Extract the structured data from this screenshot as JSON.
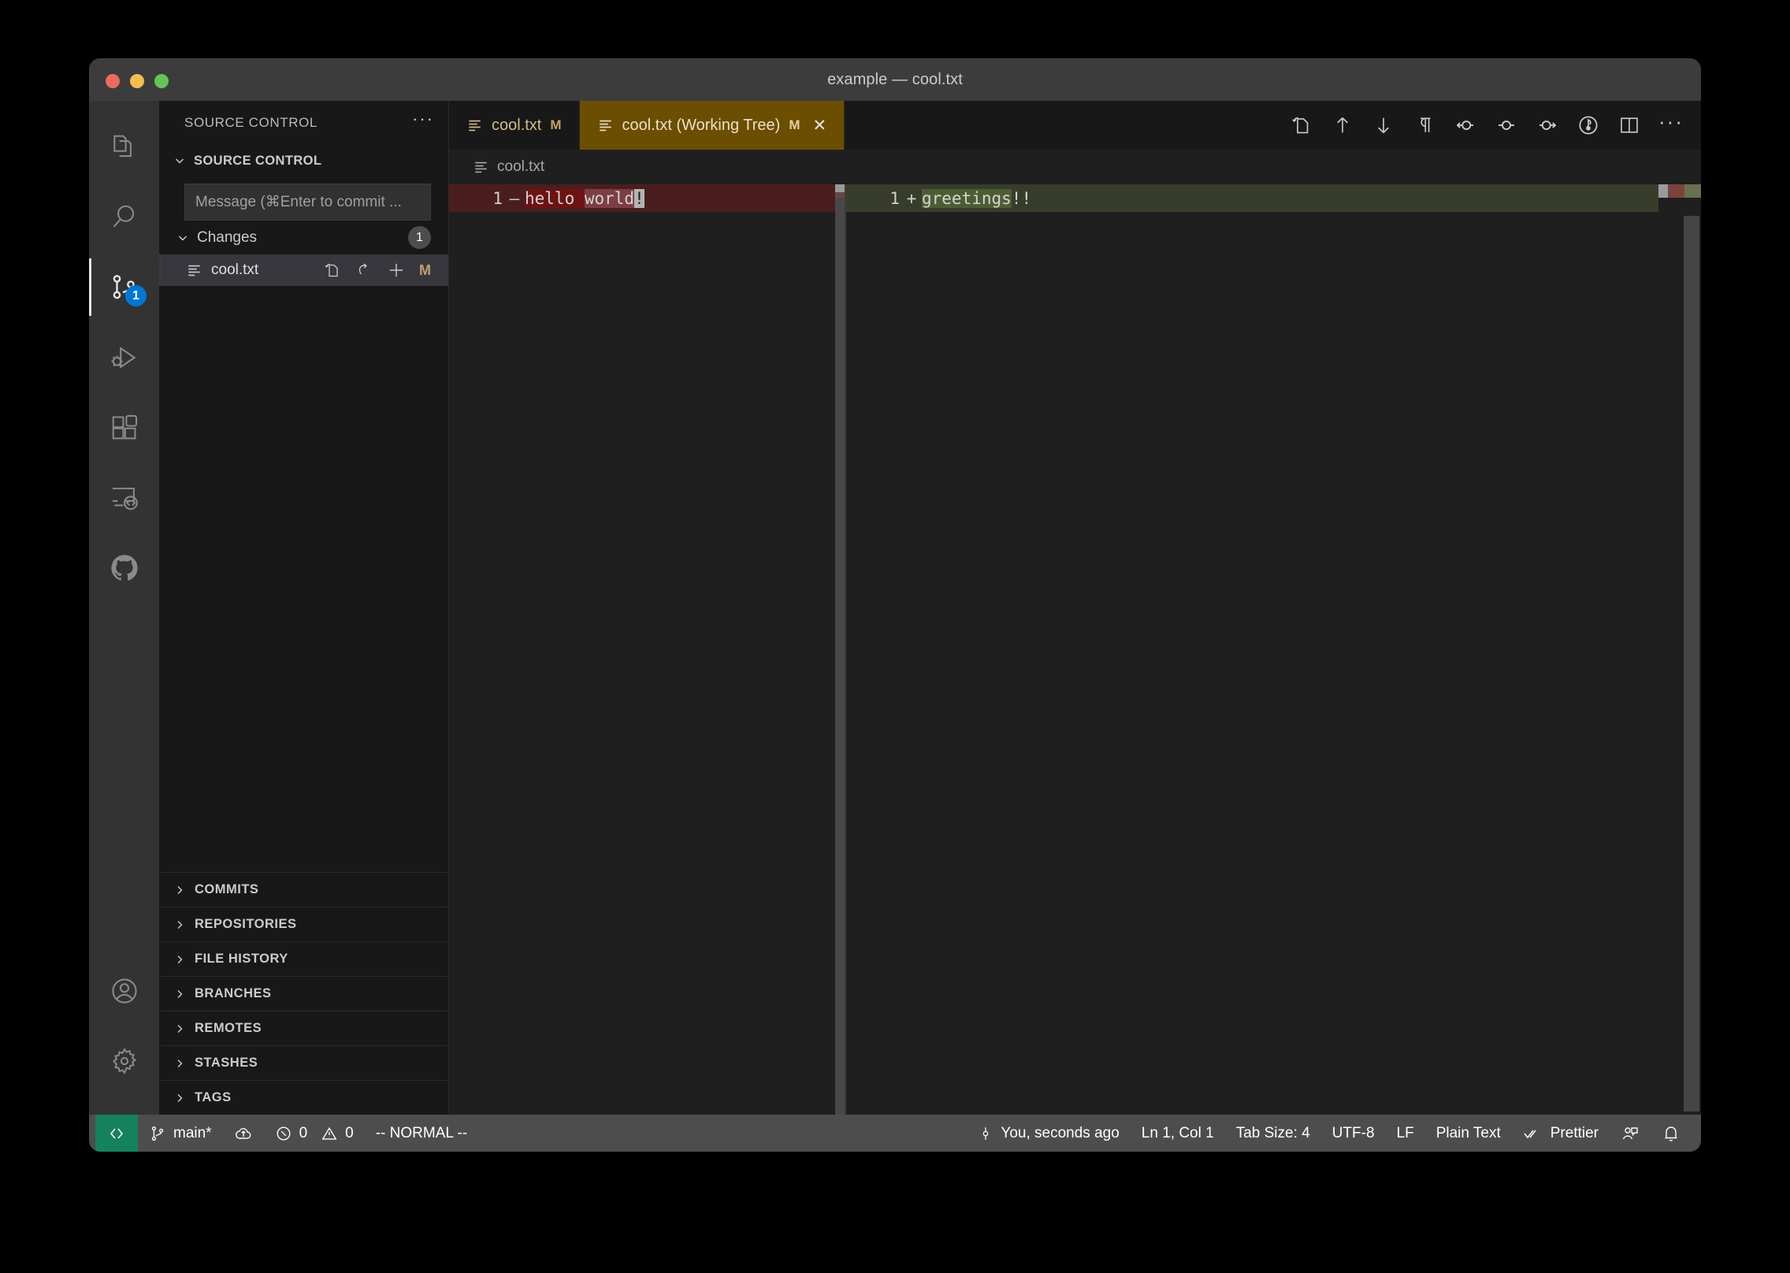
{
  "window": {
    "title": "example — cool.txt",
    "traffic_lights": [
      "close",
      "minimize",
      "zoom"
    ]
  },
  "activitybar": {
    "items": [
      {
        "name": "explorer",
        "label": "Explorer",
        "icon": "files-icon",
        "active": false,
        "badge": null
      },
      {
        "name": "search",
        "label": "Search",
        "icon": "search-icon",
        "active": false,
        "badge": null
      },
      {
        "name": "source-control",
        "label": "Source Control",
        "icon": "source-control-icon",
        "active": true,
        "badge": "1"
      },
      {
        "name": "run-and-debug",
        "label": "Run and Debug",
        "icon": "debug-icon",
        "active": false,
        "badge": null
      },
      {
        "name": "extensions",
        "label": "Extensions",
        "icon": "extensions-icon",
        "active": false,
        "badge": null
      },
      {
        "name": "remote-explorer",
        "label": "Remote Explorer",
        "icon": "remote-icon",
        "active": false,
        "badge": null
      },
      {
        "name": "github",
        "label": "GitHub",
        "icon": "github-icon",
        "active": false,
        "badge": null
      }
    ],
    "bottom": [
      {
        "name": "accounts",
        "label": "Accounts",
        "icon": "account-icon"
      },
      {
        "name": "manage",
        "label": "Manage",
        "icon": "gear-icon"
      }
    ]
  },
  "sidebar": {
    "title": "SOURCE CONTROL",
    "more_actions": "···",
    "section_title": "SOURCE CONTROL",
    "commit_input": {
      "placeholder": "Message (⌘Enter to commit ...",
      "value": ""
    },
    "changes": {
      "label": "Changes",
      "count": "1",
      "files": [
        {
          "name": "cool.txt",
          "status": "M",
          "actions": [
            "open-file",
            "discard-changes",
            "stage-changes"
          ]
        }
      ]
    },
    "panels": [
      {
        "label": "COMMITS",
        "expanded": false
      },
      {
        "label": "REPOSITORIES",
        "expanded": false
      },
      {
        "label": "FILE HISTORY",
        "expanded": false
      },
      {
        "label": "BRANCHES",
        "expanded": false
      },
      {
        "label": "REMOTES",
        "expanded": false
      },
      {
        "label": "STASHES",
        "expanded": false
      },
      {
        "label": "TAGS",
        "expanded": false
      }
    ]
  },
  "editor": {
    "tabs": [
      {
        "label": "cool.txt",
        "modified": "M",
        "active": false,
        "closable": false
      },
      {
        "label": "cool.txt (Working Tree)",
        "modified": "M",
        "active": true,
        "closable": true,
        "close": "✕"
      }
    ],
    "toolbar_icons": [
      "open-file-icon",
      "previous-change-icon",
      "next-change-icon",
      "toggle-whitespace-icon",
      "stage-change-icon",
      "revert-change-icon",
      "unstage-change-icon",
      "toggle-inline-view-icon",
      "split-editor-icon",
      "more-actions-icon"
    ],
    "breadcrumb": "cool.txt",
    "diff": {
      "original": {
        "line_number": "1",
        "sign": "—",
        "segments": [
          {
            "text": "hello ",
            "highlight": "strong"
          },
          {
            "text": "world",
            "highlight": "medium"
          },
          {
            "text": "!",
            "highlight": "cursor"
          }
        ],
        "full_text": "hello world!"
      },
      "modified": {
        "line_number": "1",
        "sign": "+",
        "segments": [
          {
            "text": "greetings",
            "highlight": "strong"
          },
          {
            "text": "!!",
            "highlight": "none"
          }
        ],
        "full_text": "greetings!!"
      }
    }
  },
  "statusbar": {
    "remote_icon": "remote-indicator-icon",
    "branch": {
      "icon": "git-branch-icon",
      "label": "main*"
    },
    "sync": {
      "icon": "cloud-upload-icon",
      "label": ""
    },
    "problems": {
      "errors_icon": "error-icon",
      "errors": "0",
      "warnings_icon": "warning-icon",
      "warnings": "0"
    },
    "vim_mode": "-- NORMAL --",
    "blame": {
      "icon": "git-commit-icon",
      "label": "You, seconds ago"
    },
    "cursor_position": "Ln 1, Col 1",
    "indentation": "Tab Size: 4",
    "encoding": "UTF-8",
    "eol": "LF",
    "language": "Plain Text",
    "formatter": {
      "icon": "check-all-icon",
      "label": "Prettier"
    },
    "feedback_icon": "feedback-icon",
    "notifications_icon": "bell-icon"
  },
  "colors": {
    "accent": "#0078d4",
    "remote_green": "#16825d",
    "tab_active_bg": "#6b4e00",
    "diff_deleted_bg": "#4b1e1e",
    "diff_inserted_bg": "#373d2a",
    "diff_deleted_word": "#6d1313",
    "diff_inserted_word": "#4e5c34",
    "modified_badge": "#c5a06a"
  }
}
